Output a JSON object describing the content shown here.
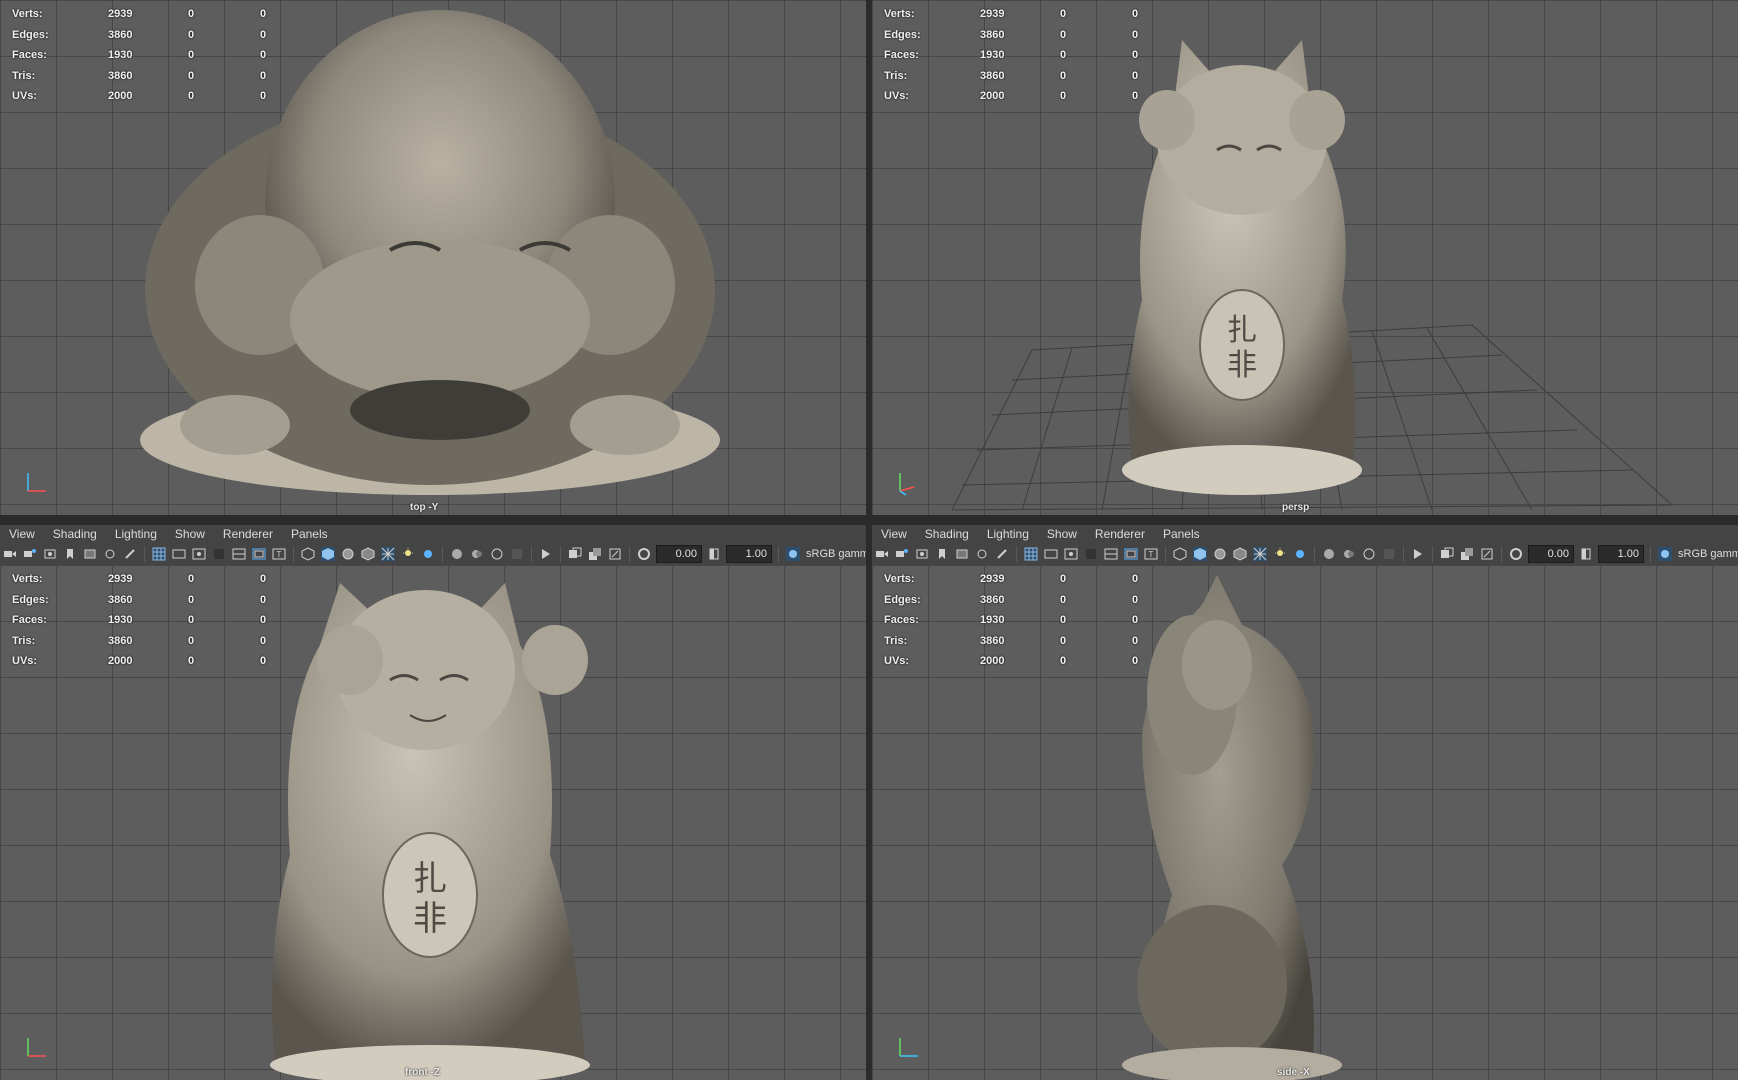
{
  "viewports": [
    {
      "camera": "top -Y",
      "stats": [
        {
          "label": "Verts:",
          "values": [
            "2939",
            "0",
            "0"
          ]
        },
        {
          "label": "Edges:",
          "values": [
            "3860",
            "0",
            "0"
          ]
        },
        {
          "label": "Faces:",
          "values": [
            "1930",
            "0",
            "0"
          ]
        },
        {
          "label": "Tris:",
          "values": [
            "3860",
            "0",
            "0"
          ]
        },
        {
          "label": "UVs:",
          "values": [
            "2000",
            "0",
            "0"
          ]
        }
      ]
    },
    {
      "camera": "persp",
      "stats": [
        {
          "label": "Verts:",
          "values": [
            "2939",
            "0",
            "0"
          ]
        },
        {
          "label": "Edges:",
          "values": [
            "3860",
            "0",
            "0"
          ]
        },
        {
          "label": "Faces:",
          "values": [
            "1930",
            "0",
            "0"
          ]
        },
        {
          "label": "Tris:",
          "values": [
            "3860",
            "0",
            "0"
          ]
        },
        {
          "label": "UVs:",
          "values": [
            "2000",
            "0",
            "0"
          ]
        }
      ]
    },
    {
      "camera": "front -Z",
      "stats": [
        {
          "label": "Verts:",
          "values": [
            "2939",
            "0",
            "0"
          ]
        },
        {
          "label": "Edges:",
          "values": [
            "3860",
            "0",
            "0"
          ]
        },
        {
          "label": "Faces:",
          "values": [
            "1930",
            "0",
            "0"
          ]
        },
        {
          "label": "Tris:",
          "values": [
            "3860",
            "0",
            "0"
          ]
        },
        {
          "label": "UVs:",
          "values": [
            "2000",
            "0",
            "0"
          ]
        }
      ]
    },
    {
      "camera": "side -X",
      "stats": [
        {
          "label": "Verts:",
          "values": [
            "2939",
            "0",
            "0"
          ]
        },
        {
          "label": "Edges:",
          "values": [
            "3860",
            "0",
            "0"
          ]
        },
        {
          "label": "Faces:",
          "values": [
            "1930",
            "0",
            "0"
          ]
        },
        {
          "label": "Tris:",
          "values": [
            "3860",
            "0",
            "0"
          ]
        },
        {
          "label": "UVs:",
          "values": [
            "2000",
            "0",
            "0"
          ]
        }
      ]
    }
  ],
  "panel_menus": [
    {
      "items": [
        "View",
        "Shading",
        "Lighting",
        "Show",
        "Renderer",
        "Panels"
      ]
    },
    {
      "items": [
        "View",
        "Shading",
        "Lighting",
        "Show",
        "Renderer",
        "Panels"
      ]
    }
  ],
  "panel_toolbars": [
    {
      "exposure": "0.00",
      "gamma": "1.00",
      "colorspace": "sRGB gamm"
    },
    {
      "exposure": "0.00",
      "gamma": "1.00",
      "colorspace": "sRGB gamm"
    }
  ],
  "icons": [
    "camera-icon",
    "bookmark-icon",
    "grid-icon",
    "wireframe-icon",
    "smooth-shade-icon",
    "textured-icon",
    "lighting-icon",
    "isolate-icon",
    "xray-icon",
    "exposure-icon",
    "gamma-icon",
    "colorspace-icon"
  ],
  "colors": {
    "viewport_bg": "#5d5d5d",
    "grid": "#474747",
    "ui_bg": "#444444",
    "statue": "#a8a296"
  }
}
